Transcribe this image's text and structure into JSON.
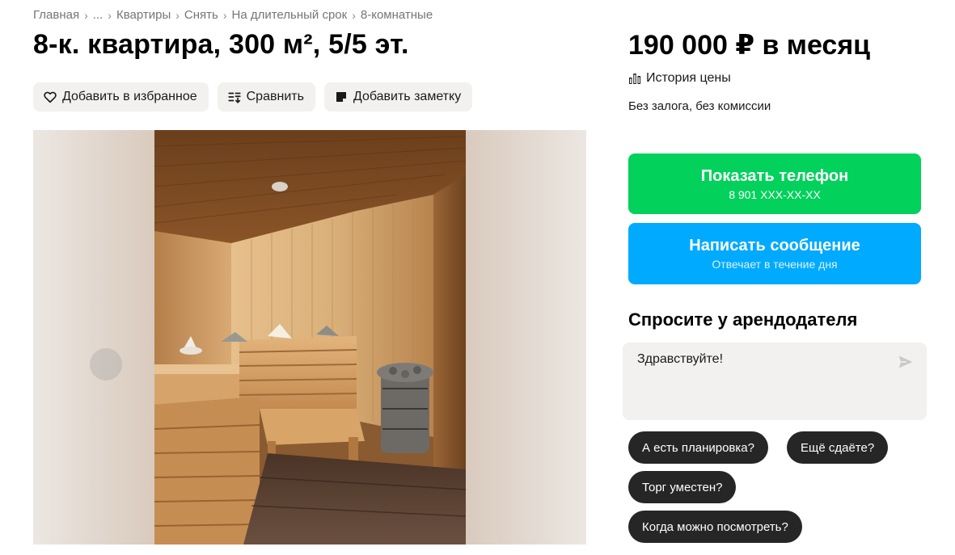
{
  "breadcrumb": [
    "Главная",
    "...",
    "Квартиры",
    "Снять",
    "На длительный срок",
    "8-комнатные"
  ],
  "title": "8-к. квартира, 300 м², 5/5 эт.",
  "actions": {
    "favorite": "Добавить в избранное",
    "compare": "Сравнить",
    "note": "Добавить заметку"
  },
  "price": "190 000 ₽ в месяц",
  "price_history": "История цены",
  "terms": "Без залога, без комиссии",
  "phone_button": {
    "label": "Показать телефон",
    "number": "8 901 XXX-XX-XX",
    "color": "#02d15c"
  },
  "message_button": {
    "label": "Написать сообщение",
    "sub": "Отвечает в течение дня",
    "color": "#00aaff"
  },
  "ask": {
    "title": "Спросите у арендодателя",
    "message": "Здравствуйте!",
    "chips": [
      "А есть планировка?",
      "Ещё сдаёте?",
      "Торг уместен?",
      "Когда можно посмотреть?"
    ]
  },
  "icons": [
    "heart-icon",
    "compare-icon",
    "note-icon",
    "chart-icon",
    "send-icon"
  ]
}
